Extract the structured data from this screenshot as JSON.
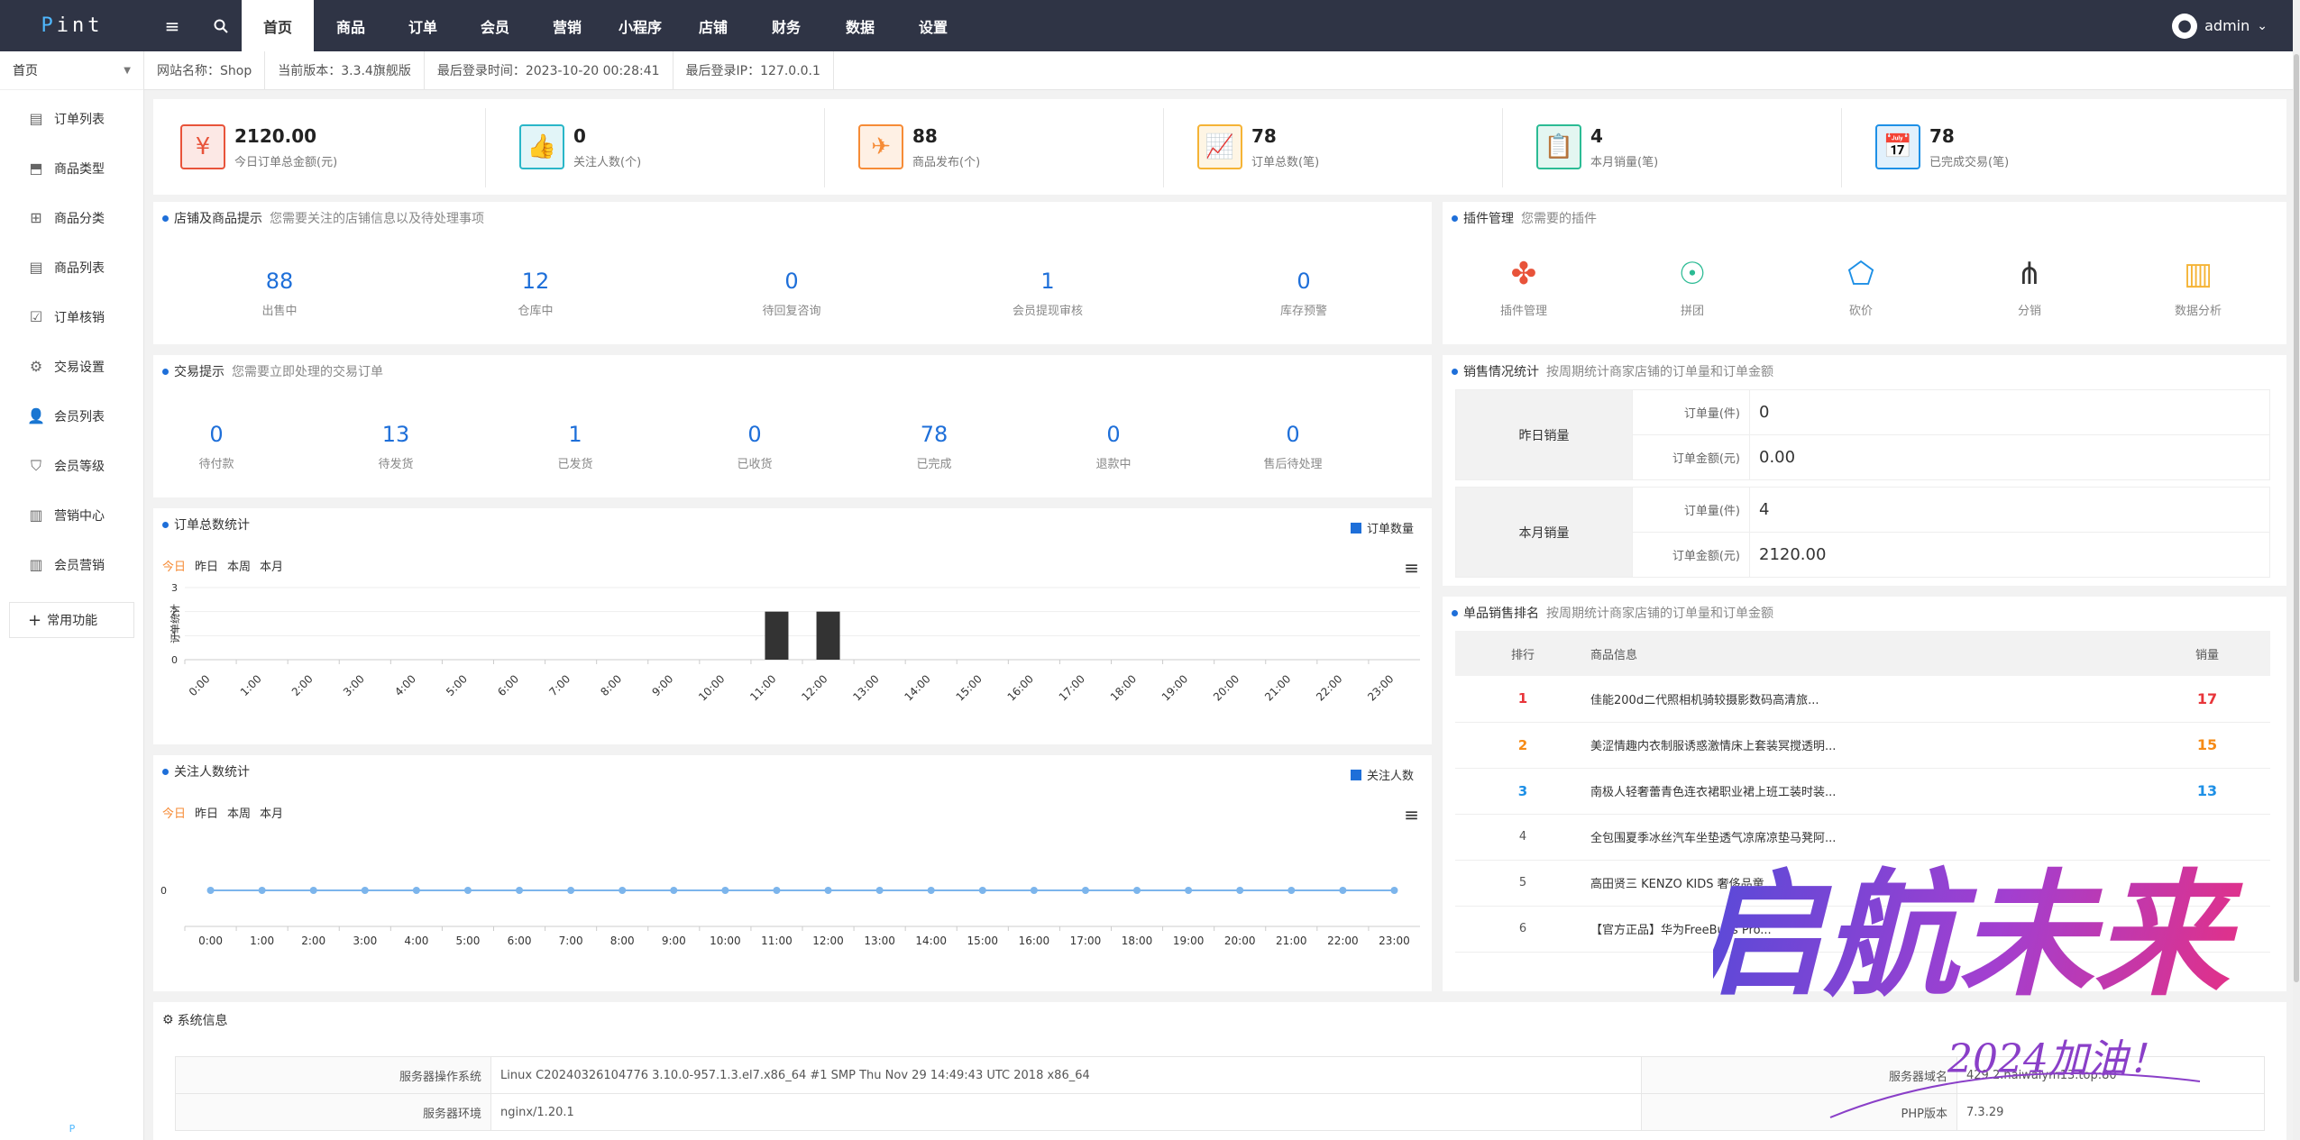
{
  "brand": {
    "logo": "Pint"
  },
  "nav": [
    {
      "label": "首页",
      "active": true
    },
    {
      "label": "商品"
    },
    {
      "label": "订单"
    },
    {
      "label": "会员"
    },
    {
      "label": "营销"
    },
    {
      "label": "小程序"
    },
    {
      "label": "店铺"
    },
    {
      "label": "财务"
    },
    {
      "label": "数据"
    },
    {
      "label": "设置"
    }
  ],
  "user": {
    "name": "admin",
    "caret": "⌄"
  },
  "sidebar": {
    "head": "首页",
    "items": [
      "订单列表",
      "商品类型",
      "商品分类",
      "商品列表",
      "订单核销",
      "交易设置",
      "会员列表",
      "会员等级",
      "营销中心",
      "会员营销"
    ],
    "add": "常用功能",
    "foot": "P"
  },
  "infobar": [
    "网站名称：Shop",
    "当前版本：3.3.4旗舰版",
    "最后登录时间：2023-10-20 00:28:41",
    "最后登录IP：127.0.0.1"
  ],
  "stats": [
    {
      "num": "2120.00",
      "label": "今日订单总金额(元)",
      "color": "#e8533a",
      "icon": "¥"
    },
    {
      "num": "0",
      "label": "关注人数(个)",
      "color": "#29b6c8",
      "icon": "👍"
    },
    {
      "num": "88",
      "label": "商品发布(个)",
      "color": "#f68b36",
      "icon": "✈"
    },
    {
      "num": "78",
      "label": "订单总数(笔)",
      "color": "#f5b335",
      "icon": "📈"
    },
    {
      "num": "4",
      "label": "本月销量(笔)",
      "color": "#2bbb94",
      "icon": "📋"
    },
    {
      "num": "78",
      "label": "已完成交易(笔)",
      "color": "#1e90e6",
      "icon": "📅"
    }
  ],
  "shop_tip": {
    "title": "店铺及商品提示",
    "sub": "您需要关注的店铺信息以及待处理事项",
    "items": [
      {
        "n": "88",
        "l": "出售中"
      },
      {
        "n": "12",
        "l": "仓库中"
      },
      {
        "n": "0",
        "l": "待回复咨询"
      },
      {
        "n": "1",
        "l": "会员提现审核"
      },
      {
        "n": "0",
        "l": "库存预警"
      }
    ]
  },
  "trade_tip": {
    "title": "交易提示",
    "sub": "您需要立即处理的交易订单",
    "items": [
      {
        "n": "0",
        "l": "待付款"
      },
      {
        "n": "13",
        "l": "待发货"
      },
      {
        "n": "1",
        "l": "已发货"
      },
      {
        "n": "0",
        "l": "已收货"
      },
      {
        "n": "78",
        "l": "已完成"
      },
      {
        "n": "0",
        "l": "退款中"
      },
      {
        "n": "0",
        "l": "售后待处理"
      }
    ]
  },
  "plugins": {
    "title": "插件管理",
    "sub": "您需要的插件",
    "items": [
      {
        "label": "插件管理",
        "icon": "puzzle-icon",
        "color": "#e8533a"
      },
      {
        "label": "拼团",
        "icon": "group-icon",
        "color": "#2bbb94"
      },
      {
        "label": "砍价",
        "icon": "tag-icon",
        "color": "#1e90e6"
      },
      {
        "label": "分销",
        "icon": "network-icon",
        "color": "#333333"
      },
      {
        "label": "数据分析",
        "icon": "bar-chart-icon",
        "color": "#f5b335"
      }
    ]
  },
  "sales_stats": {
    "title": "销售情况统计",
    "sub": "按周期统计商家店铺的订单量和订单金额",
    "rows": [
      {
        "group": "昨日销量",
        "k1": "订单量(件)",
        "v1": "0",
        "k2": "订单金额(元)",
        "v2": "0.00"
      },
      {
        "group": "本月销量",
        "k1": "订单量(件)",
        "v1": "4",
        "k2": "订单金额(元)",
        "v2": "2120.00"
      }
    ]
  },
  "ranking": {
    "title": "单品销售排名",
    "sub": "按周期统计商家店铺的订单量和订单金额",
    "headers": [
      "排行",
      "商品信息",
      "销量"
    ],
    "rows": [
      {
        "rank": "1",
        "name": "佳能200d二代照相机骑较摄影数码高清旅...",
        "sales": "17",
        "color": "#e8353a"
      },
      {
        "rank": "2",
        "name": "美涩情趣内衣制服诱惑激情床上套装冥搅透明...",
        "sales": "15",
        "color": "#f68b16"
      },
      {
        "rank": "3",
        "name": "南极人轻奢蕾青色连衣裙职业裙上班工装时装...",
        "sales": "13",
        "color": "#1e90e6"
      },
      {
        "rank": "4",
        "name": "全包围夏季冰丝汽车坐垫透气凉席凉垫马凳阿...",
        "sales": "",
        "color": "#555555"
      },
      {
        "rank": "5",
        "name": "高田贤三 KENZO KIDS 奢侈品童...",
        "sales": "",
        "color": "#555555"
      },
      {
        "rank": "6",
        "name": "【官方正品】华为FreeBuds Pro...",
        "sales": "",
        "color": "#555555"
      }
    ]
  },
  "chart_tabs": [
    "今日",
    "昨日",
    "本周",
    "本月"
  ],
  "chart_data": [
    {
      "type": "bar",
      "title": "订单总数统计",
      "legend": "订单数量",
      "ylabel": "订单统计",
      "categories": [
        "0:00",
        "1:00",
        "2:00",
        "3:00",
        "4:00",
        "5:00",
        "6:00",
        "7:00",
        "8:00",
        "9:00",
        "10:00",
        "11:00",
        "12:00",
        "13:00",
        "14:00",
        "15:00",
        "16:00",
        "17:00",
        "18:00",
        "19:00",
        "20:00",
        "21:00",
        "22:00",
        "23:00"
      ],
      "values": [
        0,
        0,
        0,
        0,
        0,
        0,
        0,
        0,
        0,
        0,
        0,
        2,
        2,
        0,
        0,
        0,
        0,
        0,
        0,
        0,
        0,
        0,
        0,
        0
      ],
      "ylim": [
        0,
        3
      ],
      "yticks": [
        "3",
        "2",
        "1",
        "0"
      ]
    },
    {
      "type": "line",
      "title": "关注人数统计",
      "legend": "关注人数",
      "categories": [
        "0:00",
        "1:00",
        "2:00",
        "3:00",
        "4:00",
        "5:00",
        "6:00",
        "7:00",
        "8:00",
        "9:00",
        "10:00",
        "11:00",
        "12:00",
        "13:00",
        "14:00",
        "15:00",
        "16:00",
        "17:00",
        "18:00",
        "19:00",
        "20:00",
        "21:00",
        "22:00",
        "23:00"
      ],
      "values": [
        0,
        0,
        0,
        0,
        0,
        0,
        0,
        0,
        0,
        0,
        0,
        0,
        0,
        0,
        0,
        0,
        0,
        0,
        0,
        0,
        0,
        0,
        0,
        0
      ],
      "yticks": [
        "0"
      ]
    }
  ],
  "system": {
    "title": "系统信息",
    "rows": [
      {
        "k1": "服务器操作系统",
        "v1": "Linux C20240326104776 3.10.0-957.1.3.el7.x86_64 #1 SMP Thu Nov 29 14:49:43 UTC 2018 x86_64",
        "k2": "服务器域名",
        "v2": "429.2.haiwaiym13.top:80"
      },
      {
        "k1": "服务器环境",
        "v1": "nginx/1.20.1",
        "k2": "PHP版本",
        "v2": "7.3.29"
      }
    ]
  },
  "watermark": {
    "main": "启航未来",
    "sub": "2024加油！"
  }
}
